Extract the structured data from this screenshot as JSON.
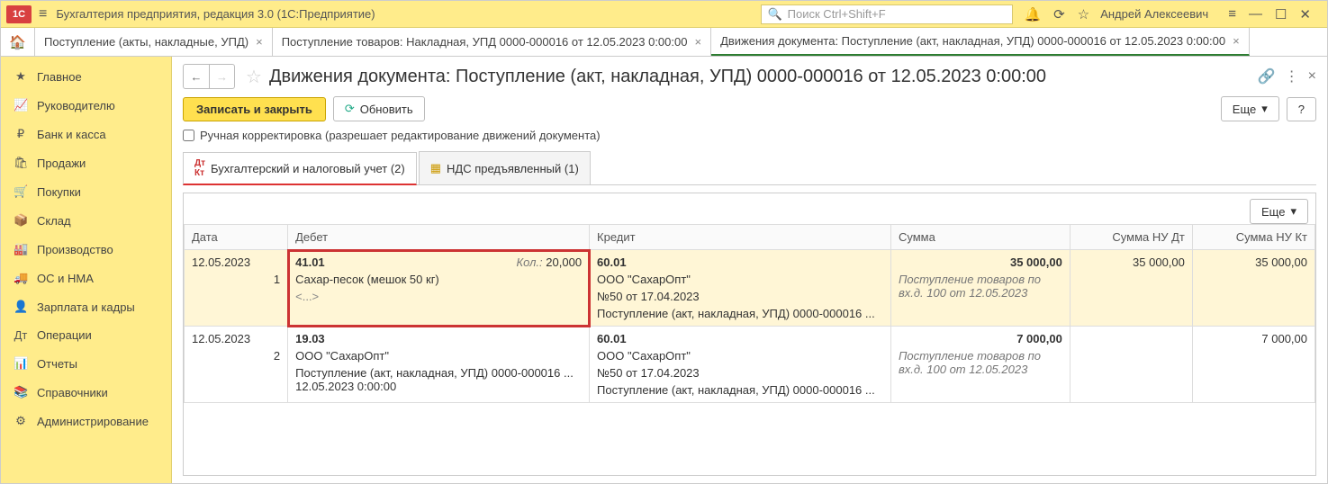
{
  "app": {
    "title": "Бухгалтерия предприятия, редакция 3.0  (1С:Предприятие)",
    "search_placeholder": "Поиск Ctrl+Shift+F",
    "user": "Андрей Алексеевич"
  },
  "tabs": [
    {
      "label": "Поступление (акты, накладные, УПД)"
    },
    {
      "label": "Поступление товаров: Накладная, УПД 0000-000016 от 12.05.2023 0:00:00"
    },
    {
      "label": "Движения документа: Поступление (акт, накладная, УПД) 0000-000016 от 12.05.2023 0:00:00"
    }
  ],
  "sidebar": {
    "items": [
      {
        "icon": "★",
        "label": "Главное"
      },
      {
        "icon": "📈",
        "label": "Руководителю"
      },
      {
        "icon": "₽",
        "label": "Банк и касса"
      },
      {
        "icon": "🛍",
        "label": "Продажи"
      },
      {
        "icon": "🛒",
        "label": "Покупки"
      },
      {
        "icon": "📦",
        "label": "Склад"
      },
      {
        "icon": "🏭",
        "label": "Производство"
      },
      {
        "icon": "🚚",
        "label": "ОС и НМА"
      },
      {
        "icon": "👤",
        "label": "Зарплата и кадры"
      },
      {
        "icon": "Дт",
        "label": "Операции"
      },
      {
        "icon": "📊",
        "label": "Отчеты"
      },
      {
        "icon": "📚",
        "label": "Справочники"
      },
      {
        "icon": "⚙",
        "label": "Администрирование"
      }
    ]
  },
  "doc": {
    "title": "Движения документа: Поступление (акт, накладная, УПД) 0000-000016 от 12.05.2023 0:00:00",
    "save_close": "Записать и закрыть",
    "refresh": "Обновить",
    "more": "Еще",
    "manual_label": "Ручная корректировка (разрешает редактирование движений документа)"
  },
  "subtabs": [
    {
      "label": "Бухгалтерский и налоговый учет (2)"
    },
    {
      "label": "НДС предъявленный (1)"
    }
  ],
  "table": {
    "more": "Еще",
    "headers": {
      "date": "Дата",
      "debit": "Дебет",
      "credit": "Кредит",
      "sum": "Сумма",
      "sum_nu_dt": "Сумма НУ Дт",
      "sum_nu_kt": "Сумма НУ Кт"
    },
    "rows": [
      {
        "date": "12.05.2023",
        "n": "1",
        "debit": {
          "acct": "41.01",
          "qty_label": "Кол.:",
          "qty": "20,000",
          "sub1": "Сахар-песок (мешок 50 кг)",
          "sub2": "<...>"
        },
        "credit": {
          "acct": "60.01",
          "sub1": "ООО \"СахарОпт\"",
          "sub2": "№50 от 17.04.2023",
          "sub3": "Поступление (акт, накладная, УПД) 0000-000016 ..."
        },
        "sum": "35 000,00",
        "note": "Поступление товаров по вх.д. 100 от 12.05.2023",
        "nu_dt": "35 000,00",
        "nu_kt": "35 000,00"
      },
      {
        "date": "12.05.2023",
        "n": "2",
        "debit": {
          "acct": "19.03",
          "sub1": "ООО \"СахарОпт\"",
          "sub2": "Поступление (акт, накладная, УПД) 0000-000016 ... 12.05.2023 0:00:00"
        },
        "credit": {
          "acct": "60.01",
          "sub1": "ООО \"СахарОпт\"",
          "sub2": "№50 от 17.04.2023",
          "sub3": "Поступление (акт, накладная, УПД) 0000-000016 ..."
        },
        "sum": "7 000,00",
        "note": "Поступление товаров по вх.д. 100 от 12.05.2023",
        "nu_dt": "",
        "nu_kt": "7 000,00"
      }
    ]
  }
}
